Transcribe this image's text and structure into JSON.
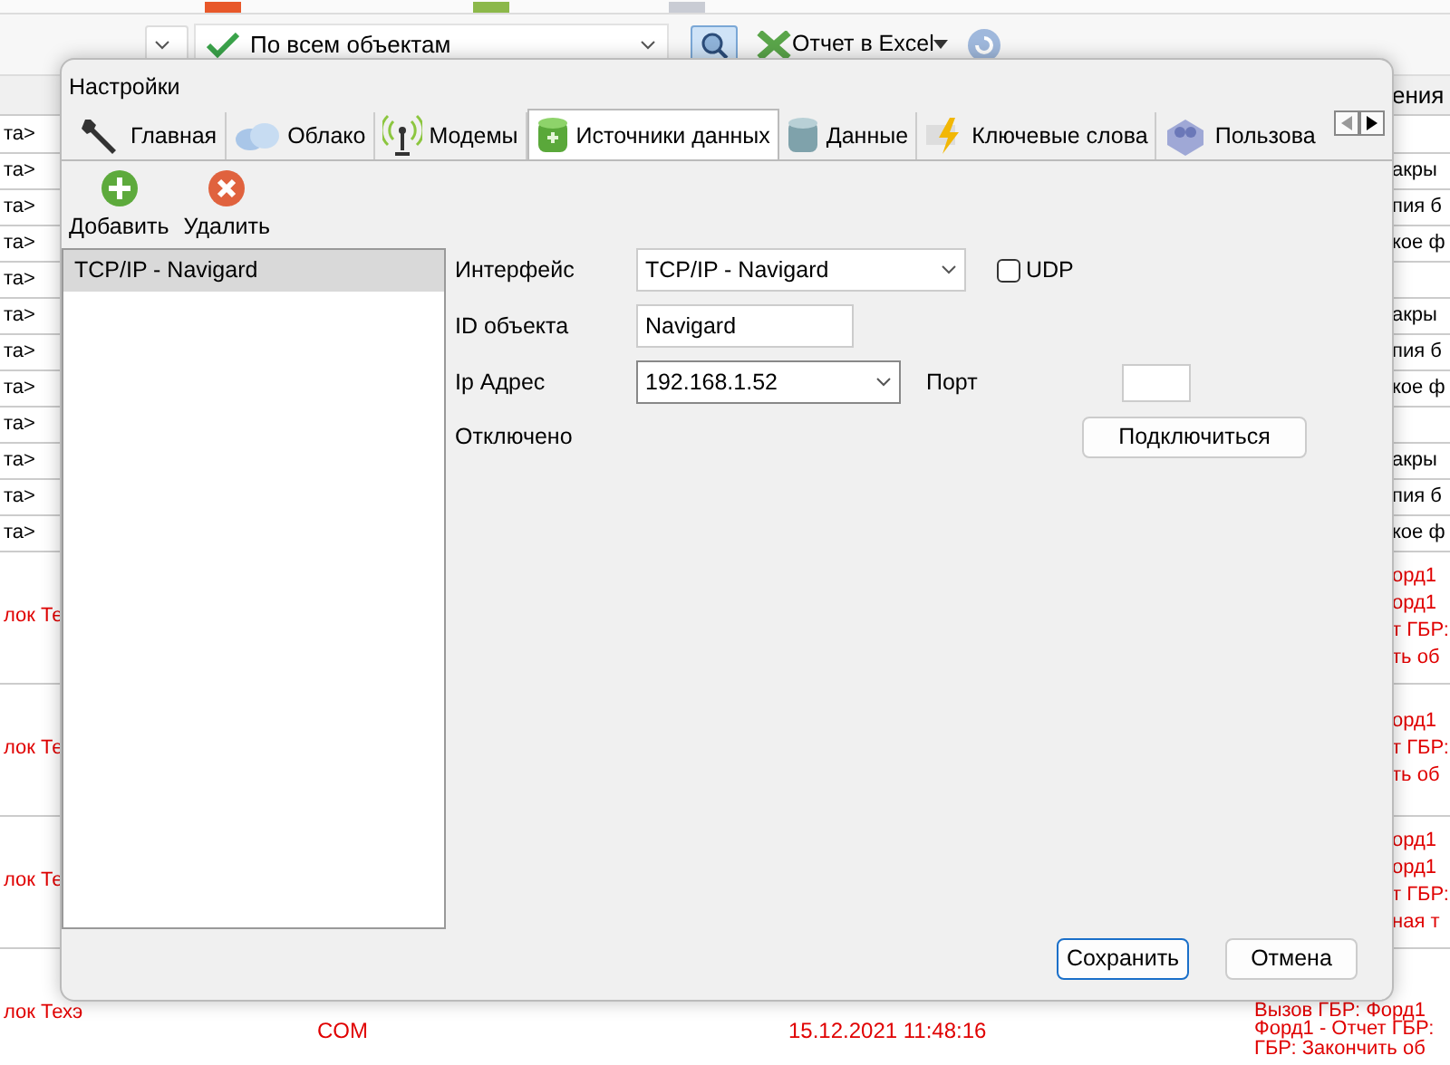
{
  "toolbar": {
    "object_filter": "По всем объектам",
    "excel_button": "Отчет в Excel"
  },
  "grid": {
    "header_text": "ения",
    "rows": [
      {
        "kind": "normal",
        "col_1": "та>",
        "col_4": []
      },
      {
        "kind": "normal",
        "col_1": "та>",
        "col_4": [
          "акры"
        ]
      },
      {
        "kind": "normal",
        "col_1": "та>",
        "col_4": [
          "пия б"
        ]
      },
      {
        "kind": "normal",
        "col_1": "та>",
        "col_4": [
          "кое ф"
        ]
      },
      {
        "kind": "normal",
        "col_1": "та>",
        "col_4": []
      },
      {
        "kind": "normal",
        "col_1": "та>",
        "col_4": [
          "акры"
        ]
      },
      {
        "kind": "normal",
        "col_1": "та>",
        "col_4": [
          "пия б"
        ]
      },
      {
        "kind": "normal",
        "col_1": "та>",
        "col_4": [
          "кое ф"
        ]
      },
      {
        "kind": "normal",
        "col_1": "та>",
        "col_4": []
      },
      {
        "kind": "normal",
        "col_1": "та>",
        "col_4": [
          "акры"
        ]
      },
      {
        "kind": "normal",
        "col_1": "та>",
        "col_4": [
          "пия б"
        ]
      },
      {
        "kind": "normal",
        "col_1": "та>",
        "col_4": [
          "кое ф"
        ]
      },
      {
        "kind": "alert",
        "col_1": "лок Те",
        "col_4": [
          "орд1",
          "орд1",
          "т ГБР:",
          "ть об"
        ]
      },
      {
        "kind": "alert",
        "col_1": "лок Те",
        "col_4": [
          "орд1",
          "т ГБР:",
          "ть об"
        ]
      },
      {
        "kind": "alert",
        "col_1": "лок Те",
        "col_4": [
          "орд1",
          "орд1",
          "т ГБР:",
          "ная т"
        ]
      },
      {
        "kind": "alert",
        "col_1": "лок Техэ",
        "col_2": "COM",
        "col_3": "15.12.2021 11:48:16",
        "col_4": [
          "Вызов ГБР: Форд1",
          "Форд1 - Отчет ГБР:",
          "ГБР: Закончить об"
        ]
      }
    ]
  },
  "dialog": {
    "title": "Настройки",
    "tabs": [
      {
        "label": "Главная",
        "selected": false
      },
      {
        "label": "Облако",
        "selected": false
      },
      {
        "label": "Модемы",
        "selected": false
      },
      {
        "label": "Источники данных",
        "selected": true
      },
      {
        "label": "Данные",
        "selected": false
      },
      {
        "label": "Ключевые слова",
        "selected": false
      },
      {
        "label": "Пользова",
        "selected": false
      }
    ],
    "actions": [
      "Добавить",
      "Удалить"
    ],
    "sources": [
      {
        "label": "TCP/IP - Navigard",
        "selected": true
      }
    ],
    "form": {
      "interface_label": "Интерфейс",
      "interface_value": "TCP/IP - Navigard",
      "udp_label": "UDP",
      "udp_checked": false,
      "object_id_label": "ID объекта",
      "object_id_value": "Navigard",
      "ip_label": "Ip Адрес",
      "ip_value": "192.168.1.52",
      "port_label": "Порт",
      "status": "Отключено",
      "connect_button": "Подключиться"
    },
    "buttons": [
      "Сохранить",
      "Отмена"
    ]
  }
}
